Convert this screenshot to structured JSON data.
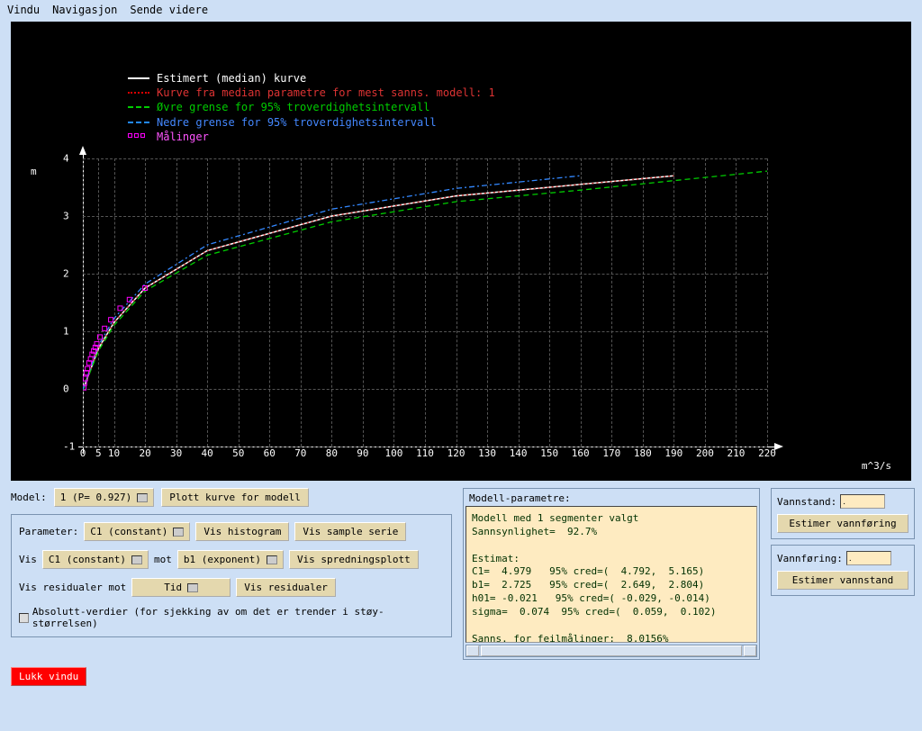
{
  "menu": {
    "vindu": "Vindu",
    "navigasjon": "Navigasjon",
    "sende": "Sende videre"
  },
  "legend": {
    "l1": "Estimert (median) kurve",
    "l2": "Kurve fra median parametre for mest sanns. modell: 1",
    "l3": "Øvre grense for 95% troverdighetsintervall",
    "l4": "Nedre grense for 95% troverdighetsintervall",
    "l5": "Målinger"
  },
  "axis": {
    "ylab": "m",
    "xlab": "m^3/s"
  },
  "yticks": [
    "-1",
    "0",
    "1",
    "2",
    "3",
    "4"
  ],
  "xticks": [
    "0",
    "5",
    "10",
    "20",
    "30",
    "40",
    "50",
    "60",
    "70",
    "80",
    "90",
    "100",
    "110",
    "120",
    "130",
    "140",
    "150",
    "160",
    "170",
    "180",
    "190",
    "200",
    "210",
    "220"
  ],
  "controls": {
    "model_label": "Model:",
    "model_value": "1 (P= 0.927)",
    "plot_model": "Plott kurve for modell",
    "parameter_label": "Parameter:",
    "param_value": "C1 (constant)",
    "vis_hist": "Vis histogram",
    "vis_sample": "Vis sample serie",
    "vis_label": "Vis",
    "vis_x": "C1 (constant)",
    "mot_label": "mot",
    "vis_y": "b1 (exponent)",
    "vis_spread": "Vis spredningsplott",
    "resid_label": "Vis residualer  mot",
    "resid_value": "Tid",
    "vis_resid": "Vis residualer",
    "abs_label": "Absolutt-verdier (for sjekking av om det er trender i støy-størrelsen)"
  },
  "param_panel": {
    "title": "Modell-parametre:",
    "body": "Modell med 1 segmenter valgt\nSannsynlighet=  92.7%\n\nEstimat:\nC1=  4.979   95% cred=(  4.792,  5.165)\nb1=  2.725   95% cred=(  2.649,  2.804)\nh01= -0.021   95% cred=( -0.029, -0.014)\nsigma=  0.074  95% cred=(  0.059,  0.102)\n\nSanns. for feilmålinger:  8.0156%"
  },
  "right": {
    "vannstand": "Vannstand:",
    "vannstand_val": ".",
    "est_vannforing": "Estimer vannføring",
    "vannforing": "Vannføring:",
    "vannforing_val": ".",
    "est_vannstand": "Estimer vannstand"
  },
  "close": "Lukk vindu",
  "chart_data": {
    "type": "line",
    "xlabel": "m^3/s",
    "ylabel": "m",
    "xlim": [
      0,
      220
    ],
    "ylim": [
      -1,
      4
    ],
    "series": [
      {
        "name": "Estimert (median) kurve",
        "style": "solid-white",
        "x": [
          0,
          5,
          10,
          20,
          40,
          80,
          120,
          160,
          190
        ],
        "y": [
          -0.02,
          0.7,
          1.15,
          1.75,
          2.4,
          3.0,
          3.35,
          3.55,
          3.7
        ]
      },
      {
        "name": "Kurve fra median parametre for mest sanns. modell: 1",
        "style": "dotted-red",
        "x": [
          0,
          5,
          10,
          20,
          40,
          80,
          120,
          160,
          190
        ],
        "y": [
          -0.02,
          0.7,
          1.15,
          1.75,
          2.4,
          3.0,
          3.35,
          3.55,
          3.7
        ]
      },
      {
        "name": "Øvre grense for 95% troverdighetsintervall (lower on plot)",
        "style": "dashed-green",
        "x": [
          0,
          5,
          10,
          20,
          40,
          80,
          120,
          160,
          220
        ],
        "y": [
          -0.03,
          0.66,
          1.1,
          1.7,
          2.32,
          2.9,
          3.25,
          3.45,
          3.78
        ]
      },
      {
        "name": "Nedre grense for 95% troverdighetsintervall (upper on plot)",
        "style": "dashed-blue",
        "x": [
          0,
          5,
          10,
          20,
          40,
          80,
          120,
          160
        ],
        "y": [
          -0.01,
          0.75,
          1.22,
          1.82,
          2.5,
          3.12,
          3.48,
          3.7
        ]
      }
    ],
    "measurements": {
      "name": "Målinger",
      "style": "magenta-square",
      "x": [
        0.3,
        0.5,
        0.8,
        1.2,
        1.5,
        2.0,
        2.5,
        3.0,
        3.5,
        4.0,
        4.5,
        5.5,
        7.0,
        9.0,
        12.0,
        15.0,
        20.0
      ],
      "y": [
        0.02,
        0.1,
        0.18,
        0.28,
        0.35,
        0.45,
        0.52,
        0.6,
        0.66,
        0.72,
        0.78,
        0.9,
        1.05,
        1.2,
        1.4,
        1.55,
        1.75
      ]
    }
  }
}
